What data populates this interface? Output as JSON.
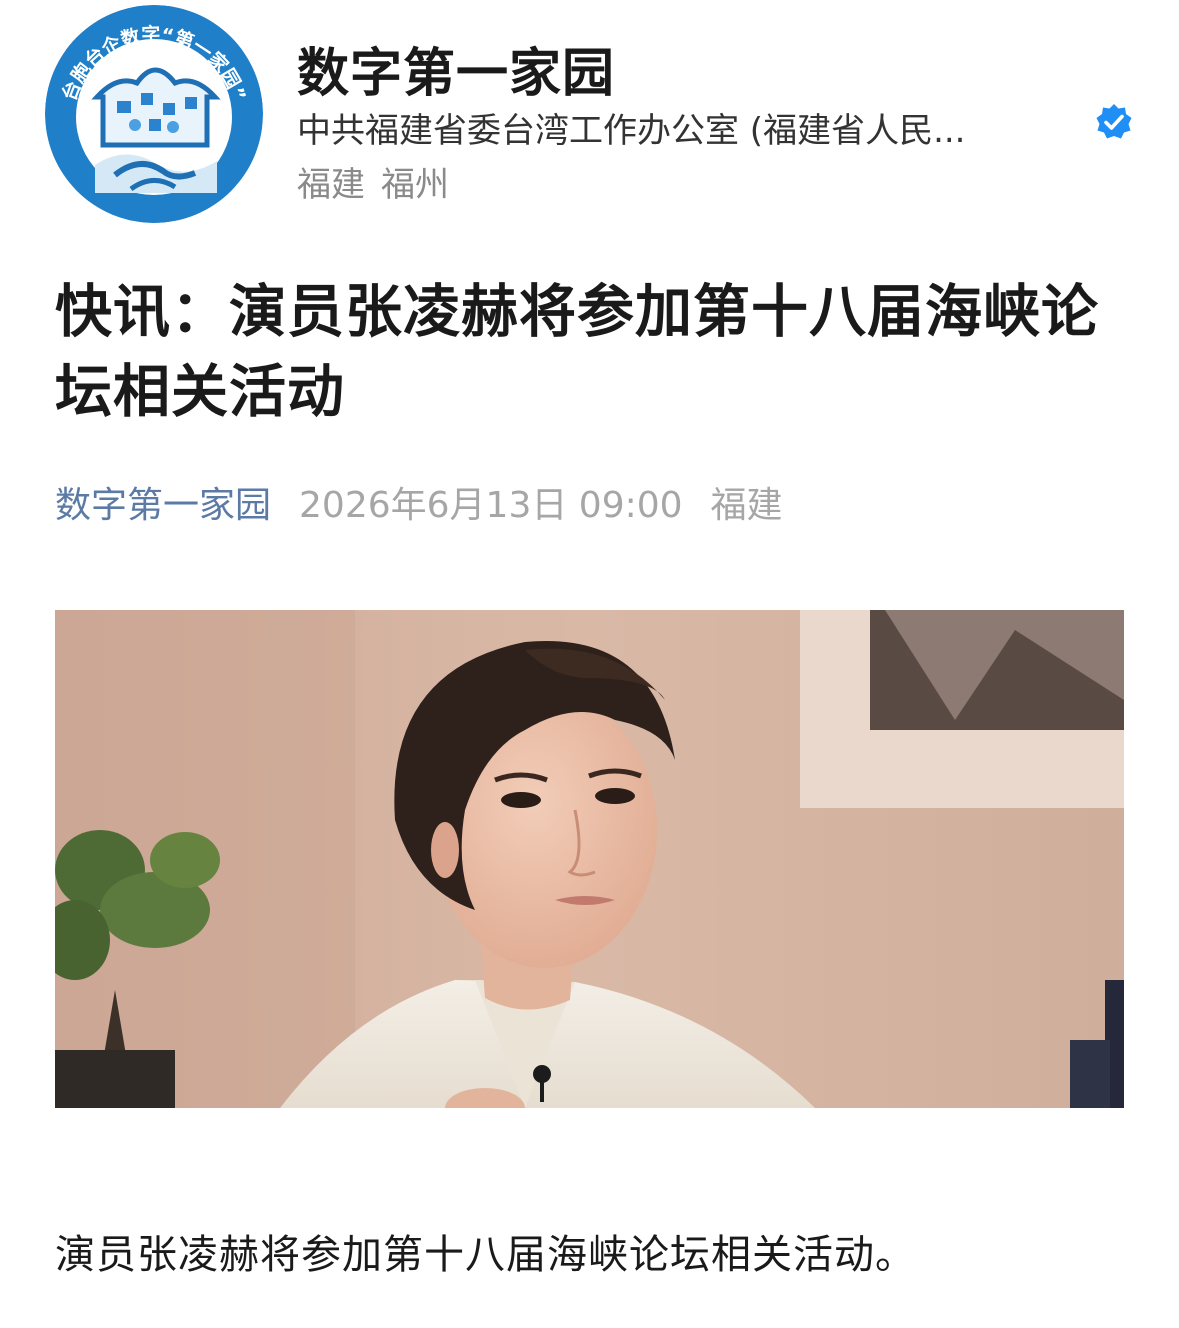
{
  "account": {
    "logo_text": "台胞台企数字“第一家园”",
    "name": "数字第一家园",
    "org": "中共福建省委台湾工作办公室 (福建省人民...",
    "verified_icon": "verified-badge-icon",
    "location": [
      "福建",
      "福州"
    ]
  },
  "article": {
    "title": "快讯：演员张凌赫将参加第十八届海峡论坛相关活动",
    "author": "数字第一家园",
    "datetime": "2026年6月13日 09:00",
    "location": "福建",
    "body": "演员张凌赫将参加第十八届海峡论坛相关活动。"
  },
  "colors": {
    "author_link": "#5b7aa6",
    "meta_gray": "#a6a6a6",
    "verified_blue": "#1f8ef5",
    "logo_blue": "#1f7fc8"
  }
}
